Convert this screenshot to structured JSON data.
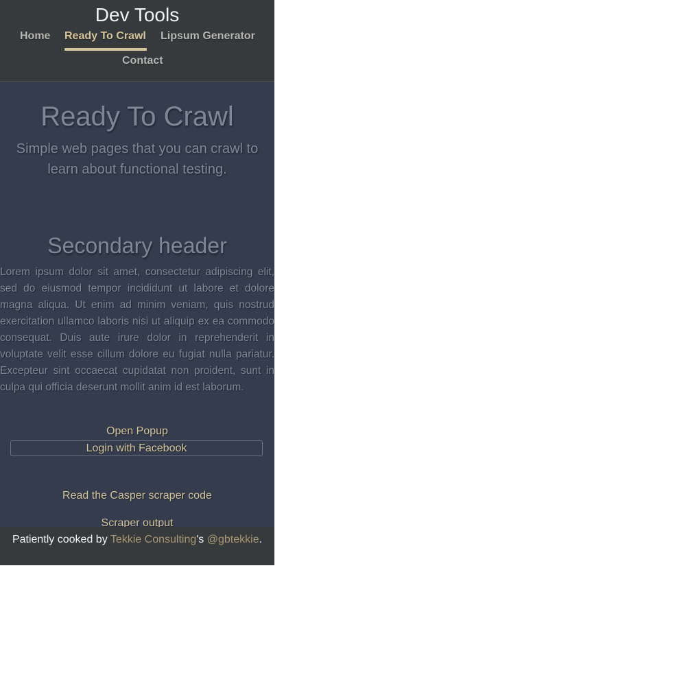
{
  "site": {
    "brand": "Dev Tools"
  },
  "nav": {
    "items": [
      {
        "label": "Home"
      },
      {
        "label": "Ready To Crawl",
        "active": true
      },
      {
        "label": "Lipsum Generator"
      },
      {
        "label": "Contact"
      }
    ]
  },
  "hero": {
    "title": "Ready To Crawl",
    "subtitle": "Simple web pages that you can crawl to learn about functional testing."
  },
  "section": {
    "title": "Secondary header",
    "body": "Lorem ipsum dolor sit amet, consectetur adipiscing elit, sed do eiusmod tempor incididunt ut labore et dolore magna aliqua. Ut enim ad minim veniam, quis nostrud exercitation ullamco laboris nisi ut aliquip ex ea commodo consequat. Duis aute irure dolor in reprehenderit in voluptate velit esse cillum dolore eu fugiat nulla pariatur. Excepteur sint occaecat cupidatat non proident, sunt in culpa qui officia deserunt mollit anim id est laborum."
  },
  "actions": {
    "open_popup": "Open Popup",
    "login_facebook": "Login with Facebook",
    "casper_link": "Read the Casper scraper code",
    "scraper_output": "Scraper output"
  },
  "footer": {
    "prefix": "Patiently cooked by ",
    "company": "Tekkie Consulting",
    "possessive": "'s ",
    "handle": "@gbtekkie",
    "suffix": "."
  },
  "colors": {
    "accent": "#d5c59b",
    "header_bg": "#363a3d",
    "main_bg": "#353c4d",
    "muted_text": "#7f8797"
  }
}
